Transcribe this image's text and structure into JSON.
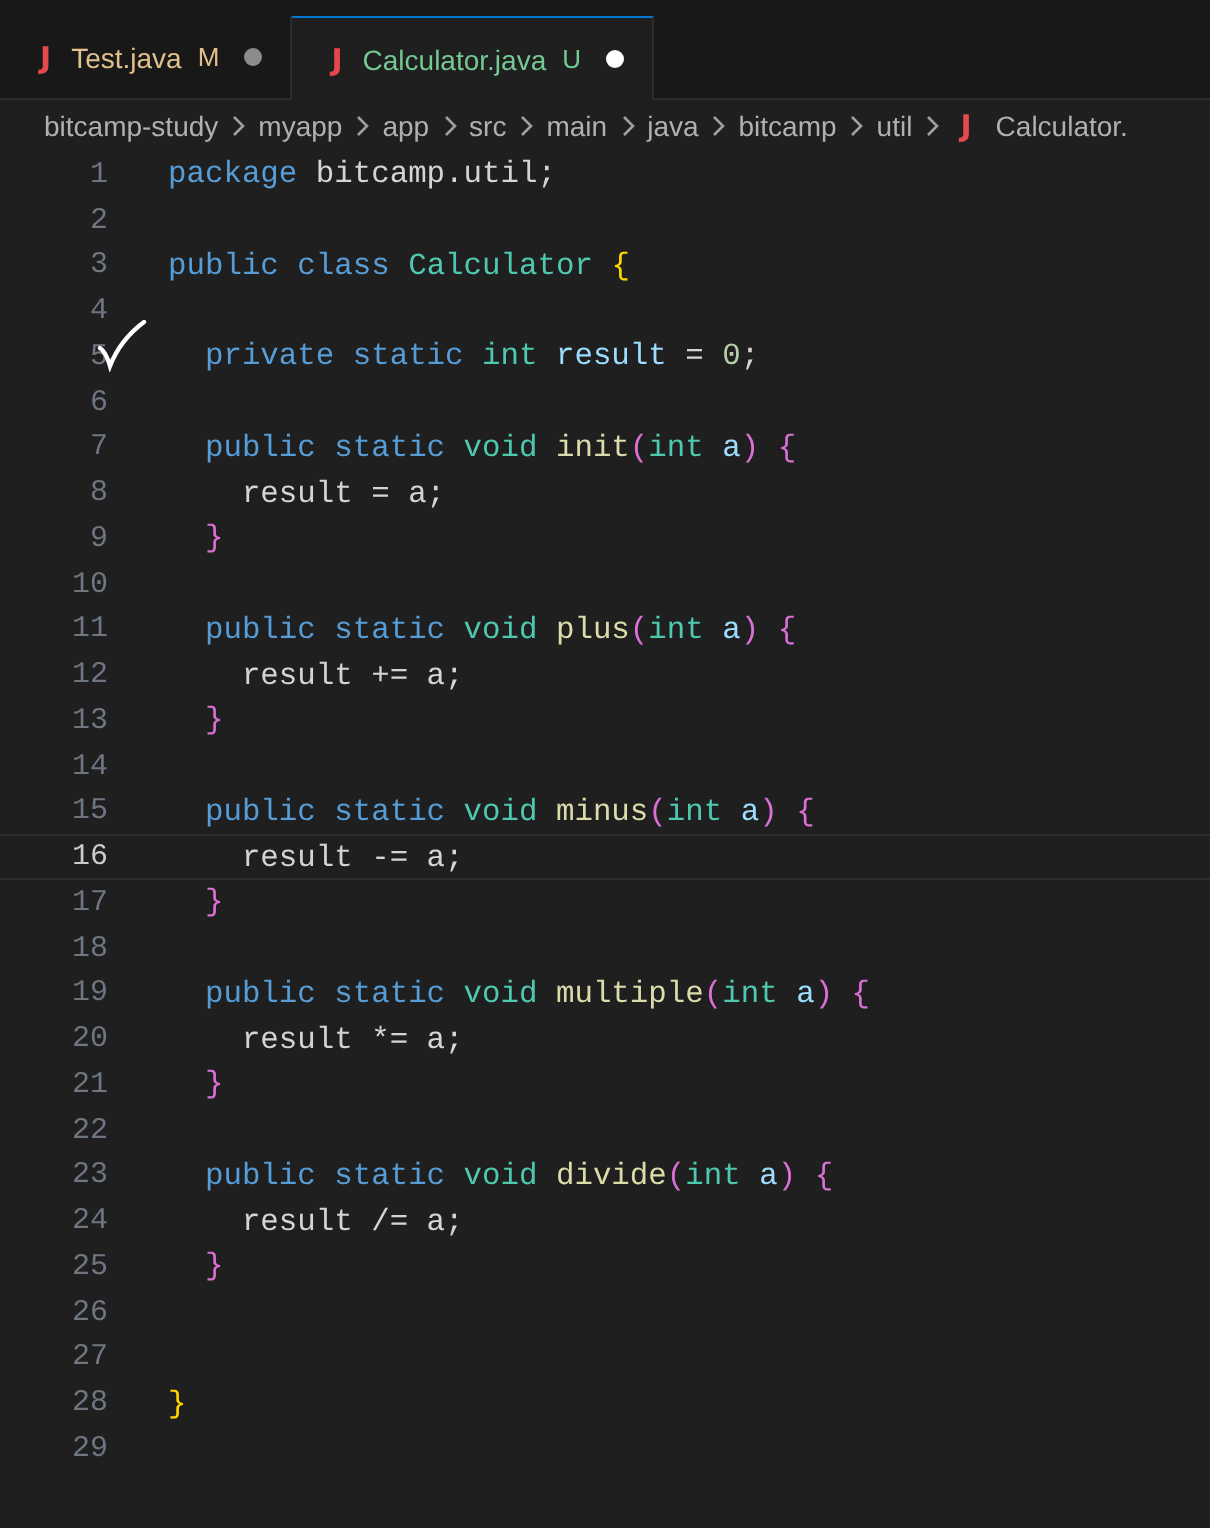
{
  "tabs": [
    {
      "icon": "J",
      "label": "Test.java",
      "status": "M",
      "color": "#e2c08d",
      "unsaved": true,
      "selected": false
    },
    {
      "icon": "J",
      "label": "Calculator.java",
      "status": "U",
      "color": "#73c991",
      "unsaved": true,
      "selected": true
    }
  ],
  "breadcrumb": {
    "folders": [
      "bitcamp-study",
      "myapp",
      "app",
      "src",
      "main",
      "java",
      "bitcamp",
      "util"
    ],
    "file_icon": "J",
    "file": "Calculator."
  },
  "editor": {
    "lines": [
      {
        "number": "1",
        "current": false,
        "tokens": [
          {
            "text": "package ",
            "kind": "keyword"
          },
          {
            "text": "bitcamp.util;",
            "kind": "plain"
          }
        ]
      },
      {
        "number": "2",
        "current": false
      },
      {
        "number": "3",
        "current": false,
        "tokens": [
          {
            "text": "public class ",
            "kind": "keyword"
          },
          {
            "text": "Calculator ",
            "kind": "type"
          },
          {
            "text": "{",
            "kind": "brace1"
          }
        ]
      },
      {
        "number": "4",
        "current": false
      },
      {
        "number": "5",
        "current": false,
        "tokens": [
          {
            "text": "  private static ",
            "kind": "keyword"
          },
          {
            "text": "int ",
            "kind": "type"
          },
          {
            "text": "result",
            "kind": "variable"
          },
          {
            "text": " = ",
            "kind": "plain"
          },
          {
            "text": "0",
            "kind": "number"
          },
          {
            "text": ";",
            "kind": "plain"
          }
        ]
      },
      {
        "number": "6",
        "current": false
      },
      {
        "number": "7",
        "current": false,
        "tokens": [
          {
            "text": "  public static ",
            "kind": "keyword"
          },
          {
            "text": "void ",
            "kind": "type"
          },
          {
            "text": "init",
            "kind": "function"
          },
          {
            "text": "(",
            "kind": "brace2"
          },
          {
            "text": "int ",
            "kind": "type"
          },
          {
            "text": "a",
            "kind": "variable"
          },
          {
            "text": ")",
            "kind": "brace2"
          },
          {
            "text": " {",
            "kind": "brace2"
          }
        ]
      },
      {
        "number": "8",
        "current": false,
        "tokens": [
          {
            "text": "    result = a;",
            "kind": "plain"
          }
        ]
      },
      {
        "number": "9",
        "current": false,
        "tokens": [
          {
            "text": "  }",
            "kind": "brace2"
          }
        ]
      },
      {
        "number": "10",
        "current": false
      },
      {
        "number": "11",
        "current": false,
        "tokens": [
          {
            "text": "  public static ",
            "kind": "keyword"
          },
          {
            "text": "void ",
            "kind": "type"
          },
          {
            "text": "plus",
            "kind": "function"
          },
          {
            "text": "(",
            "kind": "brace2"
          },
          {
            "text": "int ",
            "kind": "type"
          },
          {
            "text": "a",
            "kind": "variable"
          },
          {
            "text": ")",
            "kind": "brace2"
          },
          {
            "text": " {",
            "kind": "brace2"
          }
        ]
      },
      {
        "number": "12",
        "current": false,
        "tokens": [
          {
            "text": "    result += a;",
            "kind": "plain"
          }
        ]
      },
      {
        "number": "13",
        "current": false,
        "tokens": [
          {
            "text": "  }",
            "kind": "brace2"
          }
        ]
      },
      {
        "number": "14",
        "current": false
      },
      {
        "number": "15",
        "current": false,
        "tokens": [
          {
            "text": "  public static ",
            "kind": "keyword"
          },
          {
            "text": "void ",
            "kind": "type"
          },
          {
            "text": "minus",
            "kind": "function"
          },
          {
            "text": "(",
            "kind": "brace2"
          },
          {
            "text": "int ",
            "kind": "type"
          },
          {
            "text": "a",
            "kind": "variable"
          },
          {
            "text": ")",
            "kind": "brace2"
          },
          {
            "text": " {",
            "kind": "brace2"
          }
        ]
      },
      {
        "number": "16",
        "current": true,
        "tokens": [
          {
            "text": "    result -= a;",
            "kind": "plain"
          }
        ]
      },
      {
        "number": "17",
        "current": false,
        "tokens": [
          {
            "text": "  }",
            "kind": "brace2"
          }
        ]
      },
      {
        "number": "18",
        "current": false
      },
      {
        "number": "19",
        "current": false,
        "tokens": [
          {
            "text": "  public static ",
            "kind": "keyword"
          },
          {
            "text": "void ",
            "kind": "type"
          },
          {
            "text": "multiple",
            "kind": "function"
          },
          {
            "text": "(",
            "kind": "brace2"
          },
          {
            "text": "int ",
            "kind": "type"
          },
          {
            "text": "a",
            "kind": "variable"
          },
          {
            "text": ")",
            "kind": "brace2"
          },
          {
            "text": " {",
            "kind": "brace2"
          }
        ]
      },
      {
        "number": "20",
        "current": false,
        "tokens": [
          {
            "text": "    result *= a;",
            "kind": "plain"
          }
        ]
      },
      {
        "number": "21",
        "current": false,
        "tokens": [
          {
            "text": "  }",
            "kind": "brace2"
          }
        ]
      },
      {
        "number": "22",
        "current": false
      },
      {
        "number": "23",
        "current": false,
        "tokens": [
          {
            "text": "  public static ",
            "kind": "keyword"
          },
          {
            "text": "void ",
            "kind": "type"
          },
          {
            "text": "divide",
            "kind": "function"
          },
          {
            "text": "(",
            "kind": "brace2"
          },
          {
            "text": "int ",
            "kind": "type"
          },
          {
            "text": "a",
            "kind": "variable"
          },
          {
            "text": ")",
            "kind": "brace2"
          },
          {
            "text": " {",
            "kind": "brace2"
          }
        ]
      },
      {
        "number": "24",
        "current": false,
        "tokens": [
          {
            "text": "    result /= a;",
            "kind": "plain"
          }
        ]
      },
      {
        "number": "25",
        "current": false,
        "tokens": [
          {
            "text": "  }",
            "kind": "brace2"
          }
        ]
      },
      {
        "number": "26",
        "current": false
      },
      {
        "number": "27",
        "current": false
      },
      {
        "number": "28",
        "current": false,
        "tokens": [
          {
            "text": "}",
            "kind": "brace1"
          }
        ]
      },
      {
        "number": "29",
        "current": false
      }
    ]
  }
}
